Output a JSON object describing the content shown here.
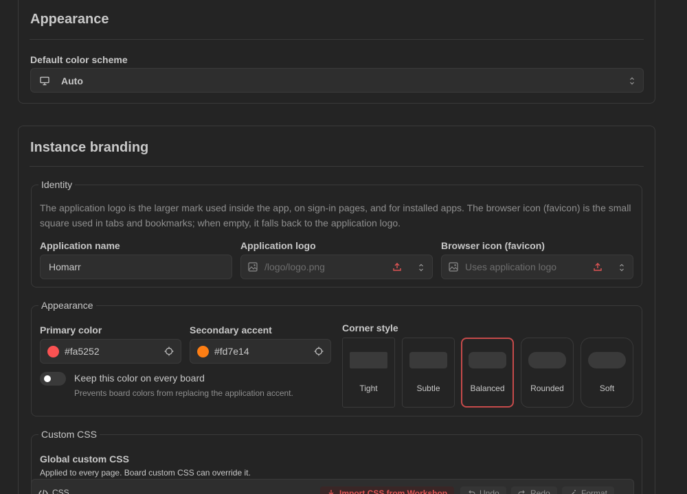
{
  "appearance": {
    "title": "Appearance",
    "color_scheme_label": "Default color scheme",
    "color_scheme_value": "Auto"
  },
  "branding": {
    "title": "Instance branding",
    "identity": {
      "legend": "Identity",
      "help": "The application logo is the larger mark used inside the app, on sign-in pages, and for installed apps. The browser icon (favicon) is the small square used in tabs and bookmarks; when empty, it falls back to the application logo.",
      "app_name_label": "Application name",
      "app_name_value": "Homarr",
      "app_logo_label": "Application logo",
      "app_logo_placeholder": "/logo/logo.png",
      "favicon_label": "Browser icon (favicon)",
      "favicon_placeholder": "Uses application logo"
    },
    "appearance": {
      "legend": "Appearance",
      "primary_label": "Primary color",
      "primary_value": "#fa5252",
      "primary_color": "#fa5252",
      "secondary_label": "Secondary accent",
      "secondary_value": "#fd7e14",
      "secondary_color": "#fd7e14",
      "keep_color_label": "Keep this color on every board",
      "keep_color_help": "Prevents board colors from replacing the application accent.",
      "corner_style_label": "Corner style",
      "corner_options": [
        "Tight",
        "Subtle",
        "Balanced",
        "Rounded",
        "Soft"
      ],
      "corner_selected": "Balanced"
    },
    "custom_css": {
      "legend": "Custom CSS",
      "global_label": "Global custom CSS",
      "global_help": "Applied to every page. Board custom CSS can override it.",
      "editor_tab": "CSS",
      "import_label": "Import CSS from Workshop",
      "undo_label": "Undo",
      "redo_label": "Redo",
      "format_label": "Format"
    }
  },
  "colors": {
    "background": "#242424",
    "surface": "#2e2e2e",
    "border": "#3a3a3a",
    "accent": "#fa5252"
  }
}
